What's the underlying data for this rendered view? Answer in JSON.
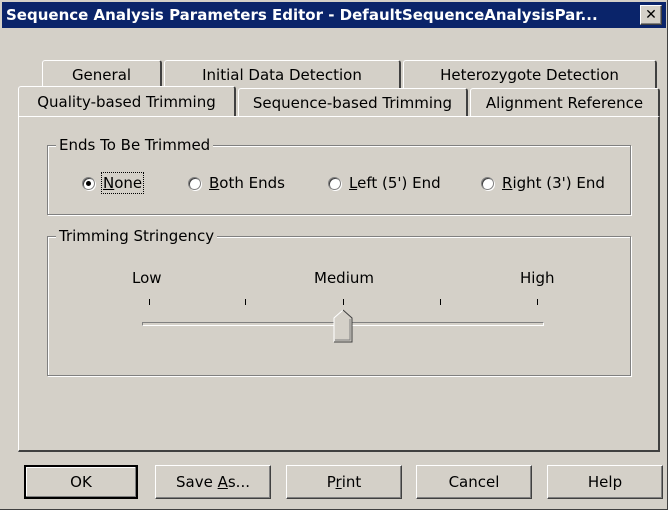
{
  "window": {
    "title": "Sequence Analysis Parameters Editor - DefaultSequenceAnalysisPar...",
    "close_glyph": "✕"
  },
  "tabs": {
    "row_back": [
      "General",
      "Initial Data Detection",
      "Heterozygote Detection"
    ],
    "row_front": [
      "Quality-based Trimming",
      "Sequence-based Trimming",
      "Alignment Reference"
    ],
    "active": "Quality-based Trimming"
  },
  "ends": {
    "label": "Ends To Be Trimmed",
    "options": [
      {
        "pre": "",
        "u": "N",
        "post": "one",
        "checked": true
      },
      {
        "pre": "",
        "u": "B",
        "post": "oth Ends",
        "checked": false
      },
      {
        "pre": "",
        "u": "L",
        "post": "eft (5') End",
        "checked": false
      },
      {
        "pre": "",
        "u": "R",
        "post": "ight (3') End",
        "checked": false
      }
    ]
  },
  "stringency": {
    "label": "Trimming Stringency",
    "low": "Low",
    "medium": "Medium",
    "high": "High",
    "value_fraction": 0.5
  },
  "buttons": {
    "ok": "OK",
    "save_as_pre": "Save ",
    "save_as_u": "A",
    "save_as_post": "s...",
    "print_pre": "P",
    "print_u": "r",
    "print_post": "int",
    "cancel": "Cancel",
    "help": "Help"
  }
}
